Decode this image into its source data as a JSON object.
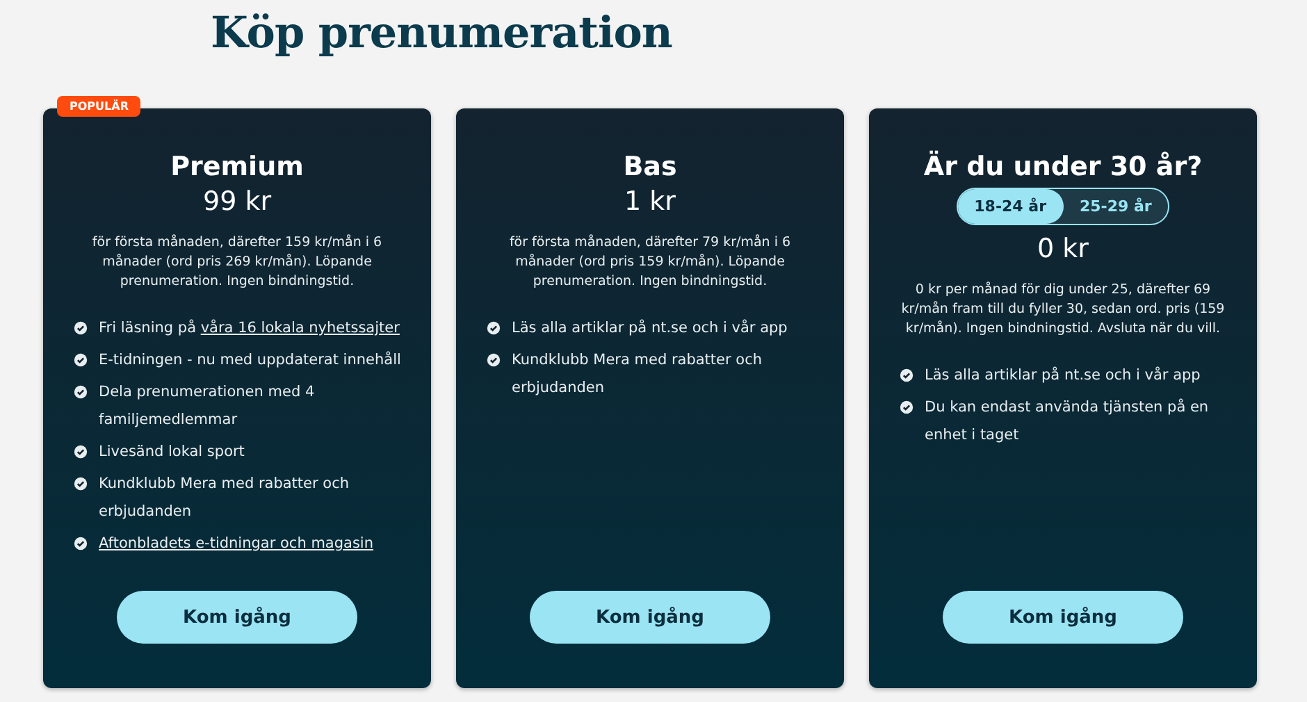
{
  "title": "Köp prenumeration",
  "plans": [
    {
      "badge": "POPULÄR",
      "name": "Premium",
      "price": "99 kr",
      "description": "för första månaden, därefter 159 kr/mån i 6 månader (ord pris 269 kr/mån). Löpande prenumeration. Ingen bindningstid.",
      "features": [
        {
          "text": "Fri läsning på",
          "link": "våra 16 lokala nyhetssajter"
        },
        {
          "text": "E-tidningen - nu med uppdaterat innehåll"
        },
        {
          "text": "Dela prenumerationen med 4 familjemedlemmar"
        },
        {
          "text": "Livesänd lokal sport"
        },
        {
          "text": "Kundklubb Mera med rabatter och erbjudanden"
        },
        {
          "link": "Aftonbladets e-tidningar och magasin"
        }
      ],
      "button": "Kom igång"
    },
    {
      "name": "Bas",
      "price": "1 kr",
      "description": "för första månaden, därefter 79 kr/mån i 6 månader (ord pris 159 kr/mån). Löpande prenumeration. Ingen bindningstid.",
      "features": [
        {
          "text": "Läs alla artiklar på nt.se och i vår app"
        },
        {
          "text": "Kundklubb Mera med rabatter och erbjudanden"
        }
      ],
      "button": "Kom igång"
    },
    {
      "name": "Är du under 30 år?",
      "options": [
        {
          "label": "18-24 år",
          "selected": true
        },
        {
          "label": "25-29 år",
          "selected": false
        }
      ],
      "price": "0 kr",
      "description": "0 kr per månad för dig under 25, därefter 69 kr/mån fram till du fyller 30, sedan ord. pris (159 kr/mån). Ingen bindningstid. Avsluta när du vill.",
      "features": [
        {
          "text": "Läs alla artiklar på nt.se och i vår app"
        },
        {
          "text": "Du kan endast använda tjänsten på en enhet i taget"
        }
      ],
      "button": "Kom igång"
    }
  ]
}
